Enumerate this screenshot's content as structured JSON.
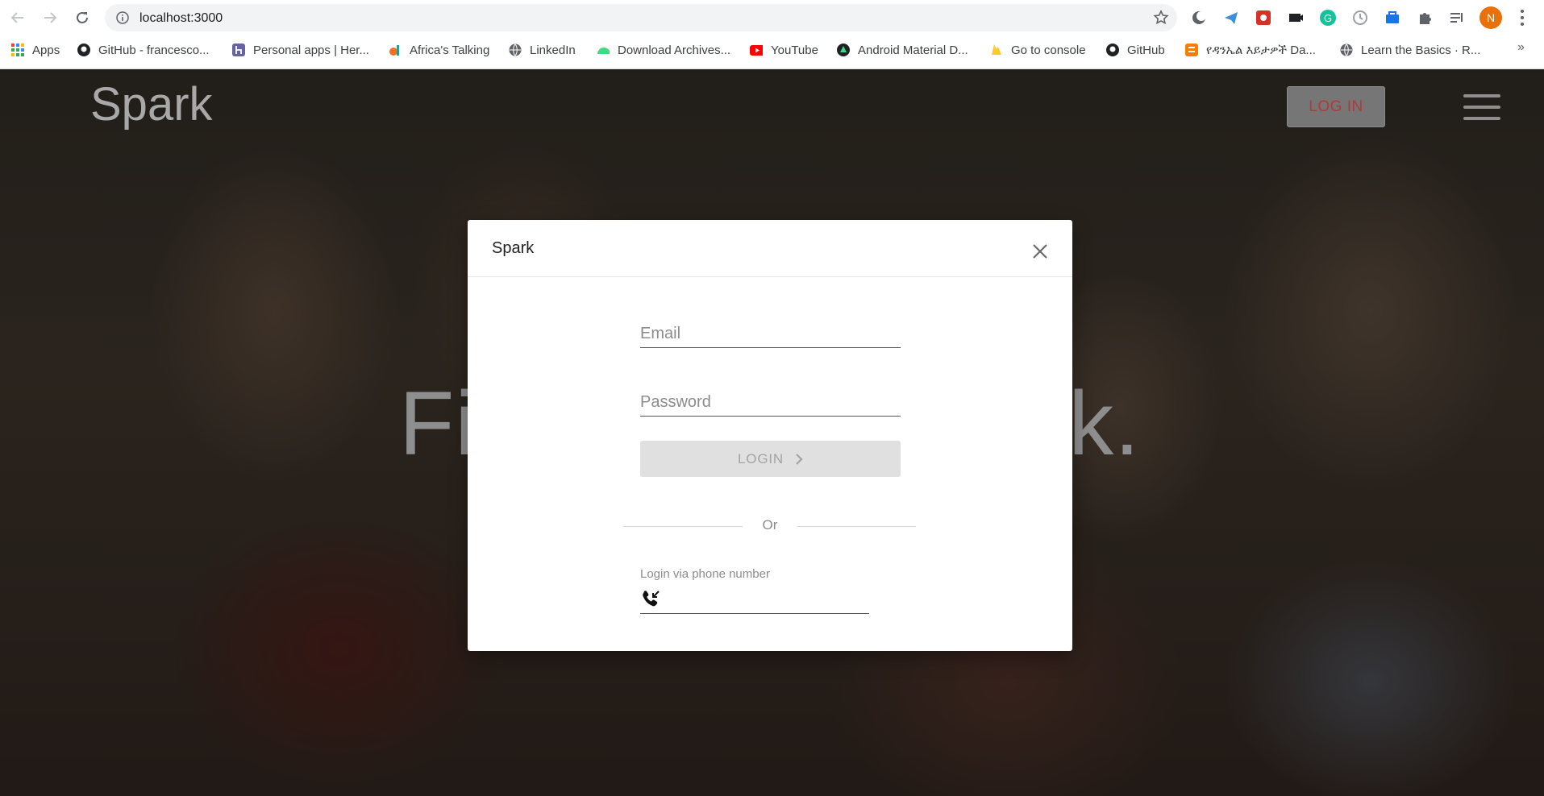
{
  "browser": {
    "url": "localhost:3000",
    "profile_initial": "N",
    "bookmarks": [
      {
        "label": "Apps",
        "icon": "apps-grid-icon"
      },
      {
        "label": "GitHub - francesco...",
        "icon": "github-icon"
      },
      {
        "label": "Personal apps | Her...",
        "icon": "heroku-icon"
      },
      {
        "label": "Africa's Talking",
        "icon": "africas-talking-icon"
      },
      {
        "label": "LinkedIn",
        "icon": "globe-icon"
      },
      {
        "label": "Download Archives...",
        "icon": "android-icon"
      },
      {
        "label": "YouTube",
        "icon": "youtube-icon"
      },
      {
        "label": "Android Material D...",
        "icon": "material-icon"
      },
      {
        "label": "Go to console",
        "icon": "firebase-icon"
      },
      {
        "label": "GitHub",
        "icon": "github-icon"
      },
      {
        "label": "የዳንኤል እይታዎች Da...",
        "icon": "blogger-icon"
      },
      {
        "label": "Learn the Basics · R...",
        "icon": "globe-icon"
      }
    ],
    "more_bookmarks": "»"
  },
  "page": {
    "brand": "Spark",
    "login_button": "LOG IN",
    "hero_text_left": "Fi",
    "hero_text_right": "k."
  },
  "modal": {
    "title": "Spark",
    "email_placeholder": "Email",
    "password_placeholder": "Password",
    "login_button": "LOGIN",
    "divider_text": "Or",
    "phone_label": "Login via phone number"
  },
  "colors": {
    "profile": "#e8710a",
    "login_top_text": "#b0393b",
    "disabled_button_bg": "#e0e0e0"
  }
}
